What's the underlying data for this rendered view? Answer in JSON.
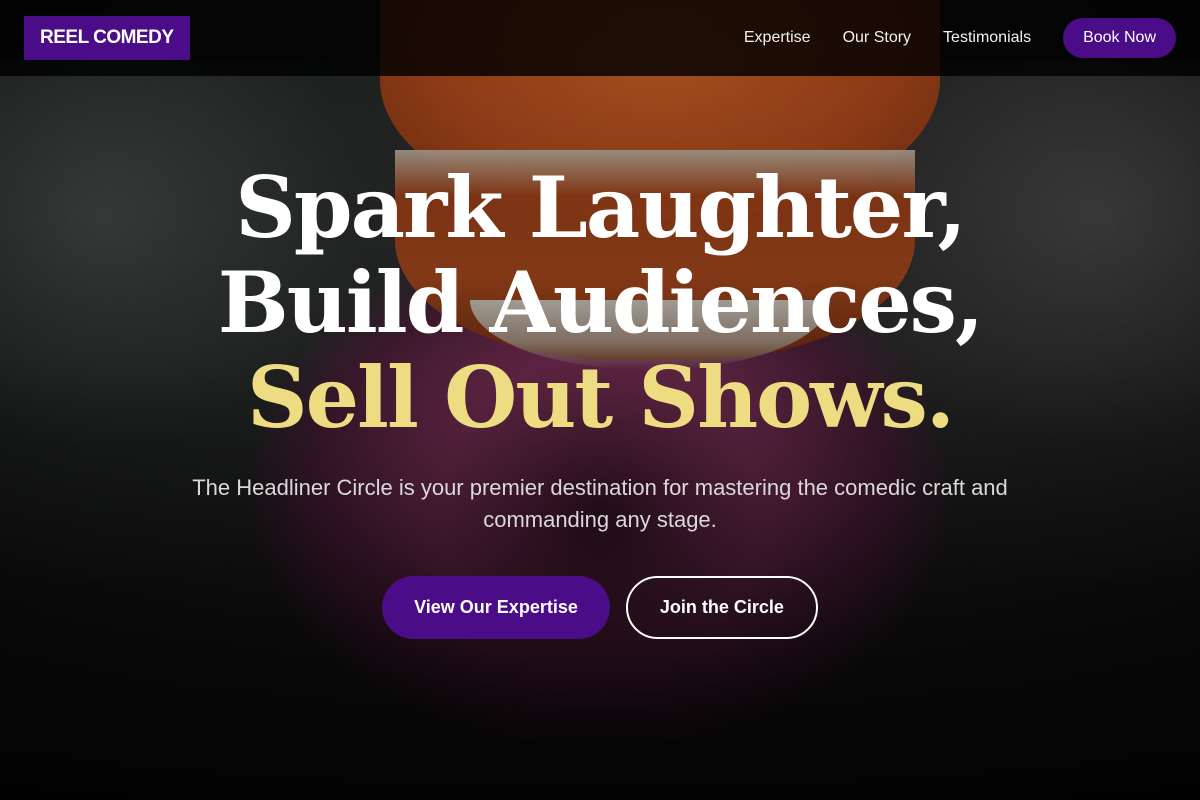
{
  "header": {
    "logo": "REEL COMEDY",
    "nav": [
      {
        "label": "Expertise"
      },
      {
        "label": "Our Story"
      },
      {
        "label": "Testimonials"
      }
    ],
    "cta": "Book Now"
  },
  "hero": {
    "headline_line1": "Spark Laughter,",
    "headline_line2": "Build Audiences,",
    "headline_line3": "Sell Out Shows.",
    "subtitle": "The Headliner Circle is your premier destination for mastering the comedic craft and commanding any stage.",
    "primary_button": "View Our Expertise",
    "secondary_button": "Join the Circle"
  },
  "colors": {
    "brand_purple": "#4b0c87",
    "accent_yellow": "#eedc82",
    "text_white": "#ffffff",
    "header_bg": "#000000"
  },
  "background_image": "comedy-prop-photo"
}
